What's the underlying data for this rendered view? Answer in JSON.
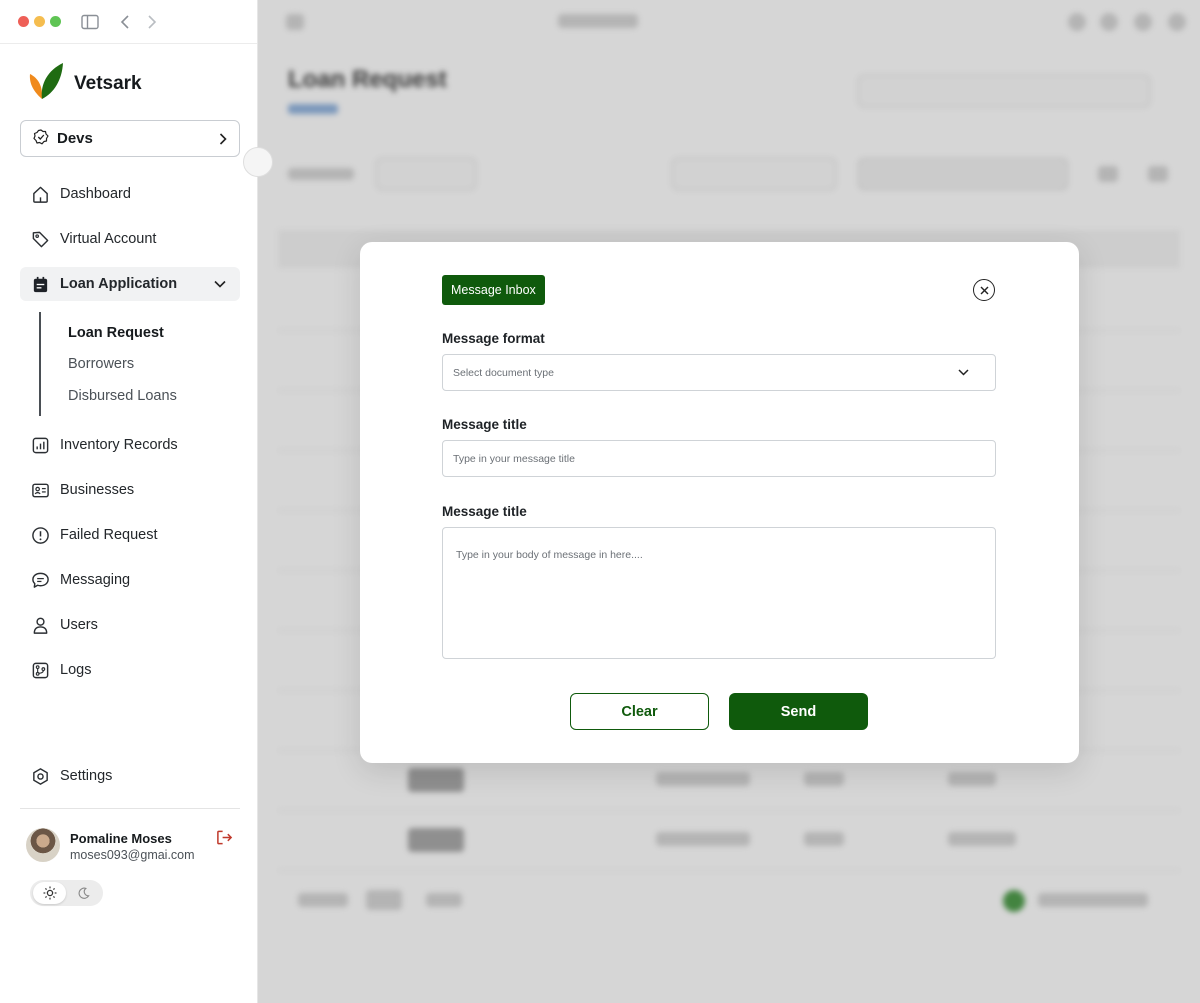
{
  "app": {
    "brand": "Vetsark",
    "workspace": "Devs"
  },
  "sidebar": {
    "items": [
      {
        "label": "Dashboard",
        "icon": "home-icon"
      },
      {
        "label": "Virtual Account",
        "icon": "tag-icon"
      },
      {
        "label": "Loan Application",
        "icon": "calendar-icon",
        "expanded": true
      },
      {
        "label": "Inventory Records",
        "icon": "chart-icon"
      },
      {
        "label": "Businesses",
        "icon": "id-card-icon"
      },
      {
        "label": "Failed Request",
        "icon": "alert-circle-icon"
      },
      {
        "label": "Messaging",
        "icon": "chat-icon"
      },
      {
        "label": "Users",
        "icon": "user-icon"
      },
      {
        "label": "Logs",
        "icon": "git-branch-icon"
      }
    ],
    "sub_items": [
      {
        "label": "Loan Request",
        "active": true
      },
      {
        "label": "Borrowers"
      },
      {
        "label": "Disbursed Loans"
      }
    ],
    "settings": "Settings"
  },
  "user": {
    "name": "Pomaline Moses",
    "email": "moses093@gmai.com"
  },
  "background": {
    "title": "Loan Request"
  },
  "modal": {
    "tag": "Message Inbox",
    "format_label": "Message format",
    "format_placeholder": "Select document type",
    "title_label": "Message title",
    "title_placeholder": "Type in your message title",
    "body_label": "Message title",
    "body_placeholder": "Type in your body of message in here....",
    "clear_label": "Clear",
    "send_label": "Send"
  },
  "colors": {
    "accent": "#0f5a0c",
    "logout": "#c0392b"
  }
}
